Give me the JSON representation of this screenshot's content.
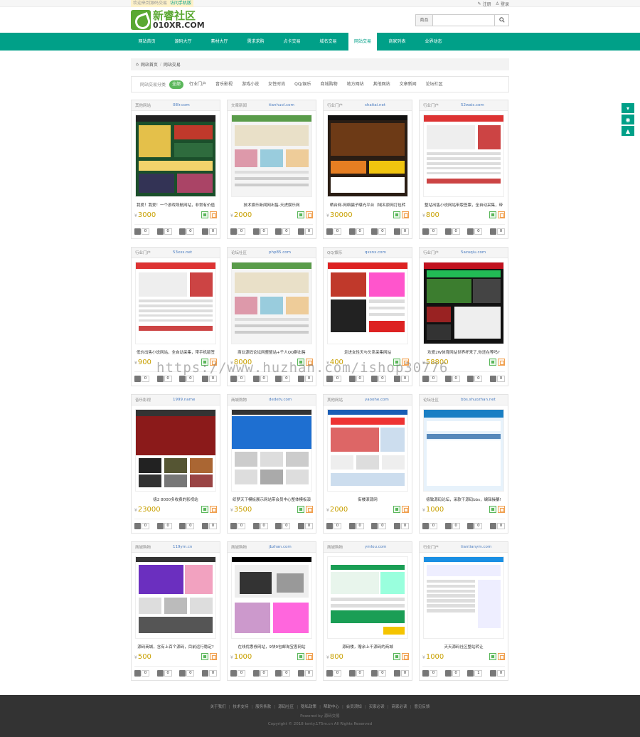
{
  "topbar": {
    "welcome": "欢迎来到源码交易",
    "mobile": "访问手机版",
    "register": "注册",
    "login": "登录"
  },
  "header": {
    "logo_cn": "新睿社区",
    "logo_en": "010XR.COM",
    "search_select": "商品",
    "search_placeholder": ""
  },
  "nav": [
    "网站首页",
    "源码大厅",
    "素材大厅",
    "需求求购",
    "点卡交易",
    "域名交易",
    "网站交易",
    "商家列表",
    "业界动态"
  ],
  "nav_active": 6,
  "breadcrumb": {
    "home": "网站首页",
    "current": "网站交易"
  },
  "categories": {
    "label": "网站交易分类",
    "items": [
      "全部",
      "行业门户",
      "音乐影视",
      "游戏小说",
      "女性时尚",
      "QQ/娱乐",
      "商城购物",
      "地方网站",
      "其他网站",
      "文章新闻",
      "论坛社区"
    ],
    "active": 0
  },
  "cards": [
    {
      "cat": "其他网站",
      "domain": "08lr.com",
      "desc": "我爱！我爱！一个游戏导航网站，非常有价值",
      "price": "3000",
      "stats": [
        "0",
        "0",
        "0",
        "0"
      ],
      "theme": "dark"
    },
    {
      "cat": "文章新闻",
      "domain": "tianhuol.com",
      "desc": "技术娱乐新闻网出售-天虎娱乐网",
      "price": "2000",
      "stats": [
        "0",
        "0",
        "0",
        "0"
      ],
      "theme": "light"
    },
    {
      "cat": "行业门户",
      "domain": "shaitai.net",
      "desc": "晒台网-网络骗子曝光平台（域名原网打包转",
      "price": "30000",
      "stats": [
        "0",
        "0",
        "0",
        "0"
      ],
      "theme": "stage"
    },
    {
      "cat": "行业门户",
      "domain": "52wais.com",
      "desc": "整站出售小说网站带版签票，全自动采集，带",
      "price": "800",
      "stats": [
        "0",
        "0",
        "0",
        "0"
      ],
      "theme": "list"
    },
    {
      "cat": "行业门户",
      "domain": "53xxs.net",
      "desc": "低价出售小说网站，全自动采集，带手机版签",
      "price": "900",
      "stats": [
        "0",
        "0",
        "0",
        "0"
      ],
      "theme": "list"
    },
    {
      "cat": "论坛社区",
      "domain": "php85.com",
      "desc": "商业源码论坛网整整站+千人QQ群出售",
      "price": "8000",
      "stats": [
        "0",
        "0",
        "0",
        "0"
      ],
      "theme": "light"
    },
    {
      "cat": "QQ/娱乐",
      "domain": "qxsnx.com",
      "desc": "走进女性天与头系采集网站",
      "price": "400",
      "stats": [
        "0",
        "0",
        "0",
        "0"
      ],
      "theme": "red"
    },
    {
      "cat": "行业门户",
      "domain": "5azuqiu.com",
      "desc": "欢爱2W体育网站世界杯来了,你还在等吗?",
      "price": "58800",
      "stats": [
        "0",
        "0",
        "0",
        "0"
      ],
      "theme": "sport"
    },
    {
      "cat": "音乐影视",
      "domain": "1999.name",
      "desc": "极2 8000多收费的影视站",
      "price": "23000",
      "stats": [
        "0",
        "0",
        "0",
        "0"
      ],
      "theme": "movie"
    },
    {
      "cat": "商城购物",
      "domain": "dedetv.com",
      "desc": "织梦天下模板展示网站带会员中心整体模板演",
      "price": "3500",
      "stats": [
        "0",
        "0",
        "0",
        "0"
      ],
      "theme": "blue"
    },
    {
      "cat": "其他网站",
      "domain": "yaoohe.com",
      "desc": "街楼滚源网",
      "price": "2000",
      "stats": [
        "0",
        "0",
        "0",
        "0"
      ],
      "theme": "shop"
    },
    {
      "cat": "论坛社区",
      "domain": "bbs.shuozhan.net",
      "desc": "极致源码论坛，采款干源码bbs，编辑操纂!",
      "price": "1000",
      "stats": [
        "0",
        "0",
        "0",
        "0"
      ],
      "theme": "forum"
    },
    {
      "cat": "商城购物",
      "domain": "119ym.cn",
      "desc": "源码商城，含有上百个源码，目前运行稳定?",
      "price": "500",
      "stats": [
        "0",
        "0",
        "0",
        "0"
      ],
      "theme": "purple"
    },
    {
      "cat": "商城购物",
      "domain": "jbzhan.com",
      "desc": "在线优惠券网站，9块9包邮淘宝客网站",
      "price": "1000",
      "stats": [
        "0",
        "0",
        "0",
        "0"
      ],
      "theme": "fashion"
    },
    {
      "cat": "商城购物",
      "domain": "ymlou.com",
      "desc": "源码楼，赠余上千源码的商城",
      "price": "800",
      "stats": [
        "0",
        "0",
        "0",
        "0"
      ],
      "theme": "green"
    },
    {
      "cat": "行业门户",
      "domain": "tiantianym.com",
      "desc": "天天源码社区整站转让",
      "price": "1000",
      "stats": [
        "0",
        "0",
        "1",
        "0"
      ],
      "theme": "list2"
    }
  ],
  "currency": "¥",
  "watermark": "https://www.huzhan.com/ishop30776",
  "footer": {
    "links": [
      "关于我们",
      "技术支持",
      "服务条款",
      "源码社区",
      "隐私政策",
      "帮助中心",
      "会员须知",
      "买家必读",
      "商家必读",
      "意见反馈"
    ],
    "powered": "Powered by 源码交易",
    "copyright": "Copyright © 2018 tenty.175m.cn All Rights Reserved"
  }
}
